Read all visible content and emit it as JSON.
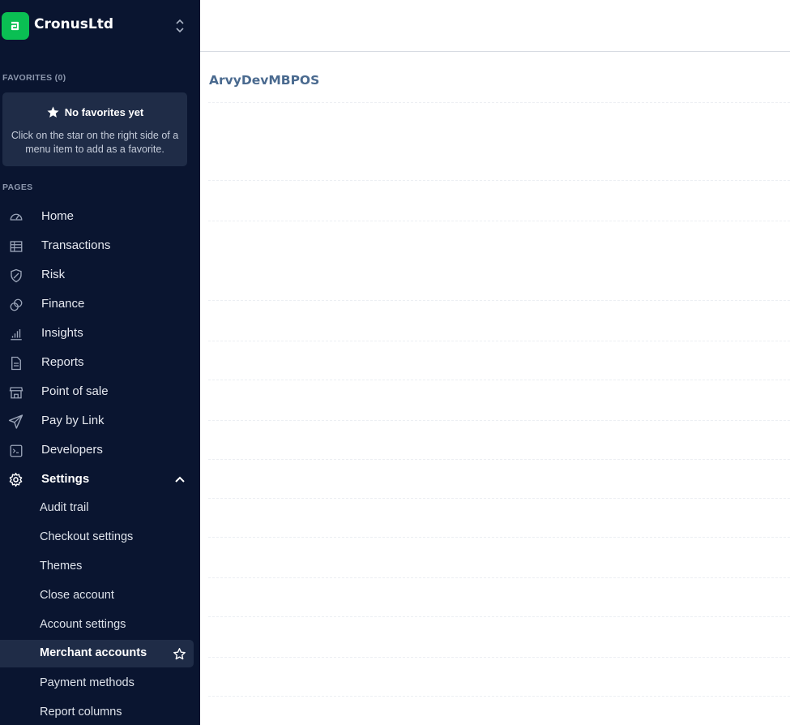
{
  "org": {
    "name": "CronusLtd",
    "logo_letter": "a",
    "brand_color": "#0abf53"
  },
  "favorites": {
    "label": "FAVORITES (0)",
    "empty_title": "No favorites yet",
    "empty_desc": "Click on the star on the right side of a menu item to add as a favorite."
  },
  "pages_label": "PAGES",
  "nav": [
    {
      "label": "Home",
      "icon": "dashboard-gauge-icon"
    },
    {
      "label": "Transactions",
      "icon": "table-icon"
    },
    {
      "label": "Risk",
      "icon": "shield-icon"
    },
    {
      "label": "Finance",
      "icon": "coins-icon"
    },
    {
      "label": "Insights",
      "icon": "bar-chart-icon"
    },
    {
      "label": "Reports",
      "icon": "document-icon"
    },
    {
      "label": "Point of sale",
      "icon": "storefront-icon"
    },
    {
      "label": "Pay by Link",
      "icon": "paper-plane-icon"
    },
    {
      "label": "Developers",
      "icon": "terminal-icon"
    },
    {
      "label": "Settings",
      "icon": "gear-icon"
    }
  ],
  "settings_sub": [
    {
      "label": "Audit trail"
    },
    {
      "label": "Checkout settings"
    },
    {
      "label": "Themes"
    },
    {
      "label": "Close account"
    },
    {
      "label": "Account settings"
    },
    {
      "label": "Merchant accounts"
    },
    {
      "label": "Payment methods"
    },
    {
      "label": "Report columns"
    }
  ],
  "main": {
    "title": "ArvyDevMBPOS"
  },
  "colors": {
    "sidebar_bg": "#0a1530",
    "sidebar_panel": "#1f2c47",
    "title_blue": "#4a6a8f"
  }
}
